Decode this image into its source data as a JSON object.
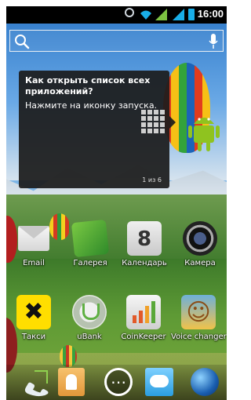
{
  "status": {
    "time": "16:00",
    "icons": [
      "alarm-icon",
      "wifi-icon",
      "signal-icon",
      "signal-icon",
      "battery-icon"
    ]
  },
  "search": {
    "icon": "search-icon",
    "mic_icon": "mic-icon"
  },
  "tip": {
    "title": "Как открыть список всех приложений?",
    "text": "Нажмите на иконку запуска.",
    "page": "1 из 6"
  },
  "apps_row1": [
    {
      "label": "Email",
      "icon": "email-icon"
    },
    {
      "label": "Галерея",
      "icon": "gallery-icon"
    },
    {
      "label": "Календарь",
      "icon": "calendar-icon"
    },
    {
      "label": "Камера",
      "icon": "camera-icon"
    }
  ],
  "apps_row2": [
    {
      "label": "Такси",
      "icon": "taxi-icon"
    },
    {
      "label": "uBank",
      "icon": "ubank-icon"
    },
    {
      "label": "CoinKeeper",
      "icon": "coinkeeper-icon"
    },
    {
      "label": "Voice changer",
      "icon": "voice-changer-icon"
    }
  ],
  "dock": [
    "phone-icon",
    "contacts-icon",
    "apps-icon",
    "messages-icon",
    "browser-icon"
  ]
}
